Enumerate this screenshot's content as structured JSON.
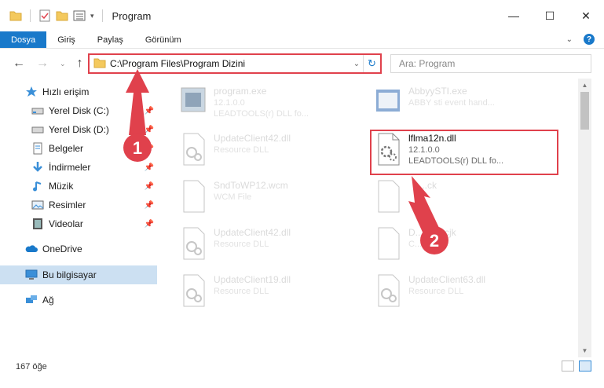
{
  "window": {
    "title": "Program",
    "controls": {
      "minimize": "—",
      "maximize": "☐",
      "close": "✕"
    }
  },
  "ribbon": {
    "tabs": [
      "Dosya",
      "Giriş",
      "Paylaş",
      "Görünüm"
    ],
    "expand_icon": "chevron-down-icon",
    "help": "?"
  },
  "address": {
    "path": "C:\\Program Files\\Program Dizini",
    "search_placeholder": "Ara: Program"
  },
  "sidebar": {
    "quick_access": "Hızlı erişim",
    "items": [
      {
        "label": "Yerel Disk (C:)",
        "icon": "drive-icon",
        "pinned": true
      },
      {
        "label": "Yerel Disk (D:)",
        "icon": "drive-icon",
        "pinned": true
      },
      {
        "label": "Belgeler",
        "icon": "documents-icon",
        "pinned": true
      },
      {
        "label": "İndirmeler",
        "icon": "downloads-icon",
        "pinned": true
      },
      {
        "label": "Müzik",
        "icon": "music-icon",
        "pinned": true
      },
      {
        "label": "Resimler",
        "icon": "pictures-icon",
        "pinned": true
      },
      {
        "label": "Videolar",
        "icon": "videos-icon",
        "pinned": true
      }
    ],
    "onedrive": "OneDrive",
    "this_pc": "Bu bilgisayar",
    "network": "Ağ"
  },
  "files": [
    {
      "name": "program.exe",
      "type": "12.1.0.0",
      "desc": "LEADTOOLS(r) DLL fo..."
    },
    {
      "name": "AbbyySTI.exe",
      "type": "ABBY sti event hand...",
      "desc": ""
    },
    {
      "name": "UpdateClient42.dll",
      "type": "Resource DLL",
      "desc": ""
    },
    {
      "name": "lflma12n.dll",
      "type": "12.1.0.0",
      "desc": "LEADTOOLS(r) DLL fo..."
    },
    {
      "name": "SndToWP12.wcm",
      "type": "WCM File",
      "desc": ""
    },
    {
      "name": "...ck",
      "type": "",
      "desc": ""
    },
    {
      "name": "UpdateClient42.dll",
      "type": "Resource DLL",
      "desc": ""
    },
    {
      "name": "D...Font.cjk",
      "type": "C...",
      "desc": ""
    },
    {
      "name": "UpdateClient19.dll",
      "type": "Resource DLL",
      "desc": ""
    },
    {
      "name": "UpdateClient63.dll",
      "type": "Resource DLL",
      "desc": ""
    }
  ],
  "status": {
    "count": "167 öğe"
  },
  "annotations": {
    "step1": "1",
    "step2": "2"
  },
  "colors": {
    "accent": "#1979ca",
    "annotation_red": "#e0414c",
    "selected_bg": "#cce0f2"
  }
}
